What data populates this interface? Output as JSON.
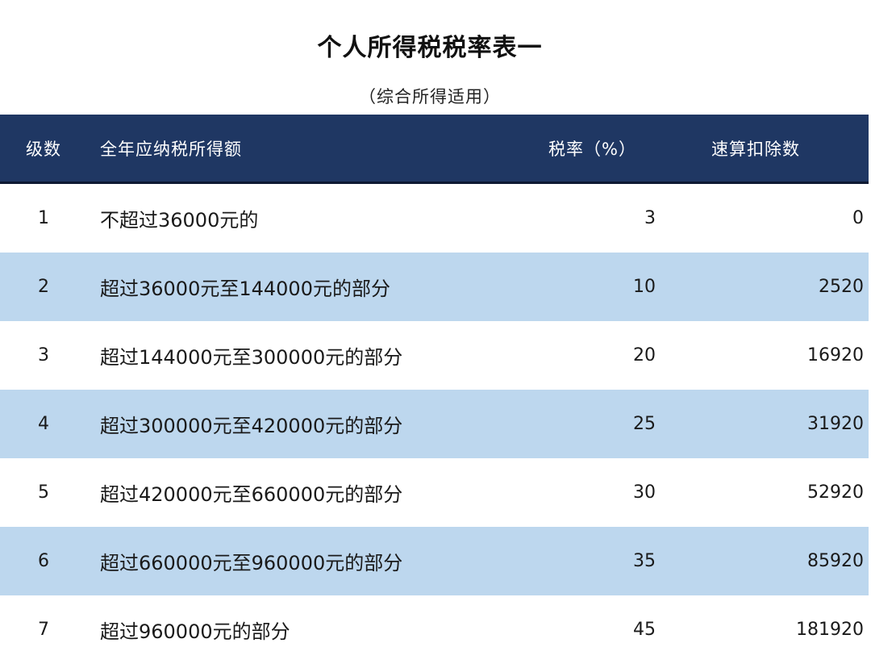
{
  "title": "个人所得税税率表一",
  "subtitle": "（综合所得适用）",
  "columns": {
    "level": "级数",
    "range": "全年应纳税所得额",
    "rate": "税率（%）",
    "deduction": "速算扣除数"
  },
  "rows": [
    {
      "level": "1",
      "range": "不超过36000元的",
      "rate": "3",
      "deduction": "0"
    },
    {
      "level": "2",
      "range": "超过36000元至144000元的部分",
      "rate": "10",
      "deduction": "2520"
    },
    {
      "level": "3",
      "range": "超过144000元至300000元的部分",
      "rate": "20",
      "deduction": "16920"
    },
    {
      "level": "4",
      "range": "超过300000元至420000元的部分",
      "rate": "25",
      "deduction": "31920"
    },
    {
      "level": "5",
      "range": "超过420000元至660000元的部分",
      "rate": "30",
      "deduction": "52920"
    },
    {
      "level": "6",
      "range": "超过660000元至960000元的部分",
      "rate": "35",
      "deduction": "85920"
    },
    {
      "level": "7",
      "range": "超过960000元的部分",
      "rate": "45",
      "deduction": "181920"
    }
  ],
  "colors": {
    "header_bg": "#1f3763",
    "shaded_row": "#bdd7ee"
  }
}
